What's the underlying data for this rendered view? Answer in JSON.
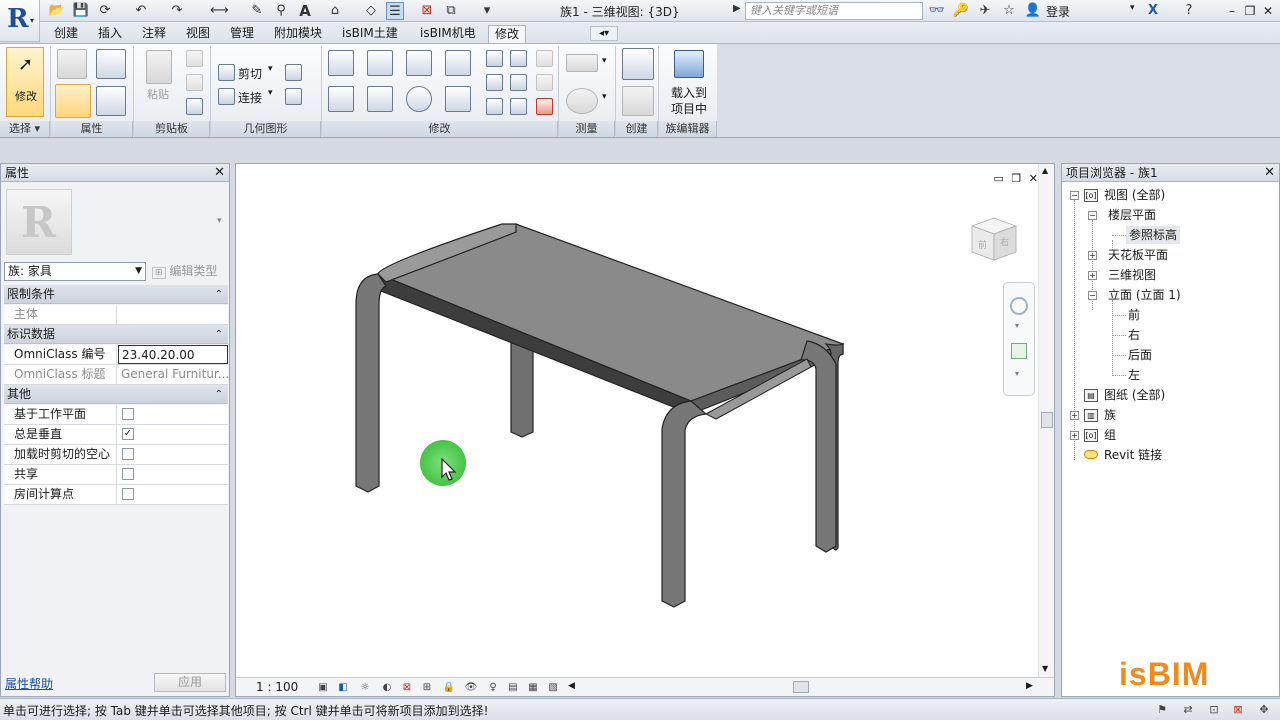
{
  "titlebar": {
    "title": "族1 - 三维视图: {3D}",
    "search_placeholder": "键入关键字或短语",
    "login": "登录"
  },
  "tabs": [
    {
      "label": "创建"
    },
    {
      "label": "插入"
    },
    {
      "label": "注释"
    },
    {
      "label": "视图"
    },
    {
      "label": "管理"
    },
    {
      "label": "附加模块"
    },
    {
      "label": "isBIM土建"
    },
    {
      "label": "isBIM机电"
    },
    {
      "label": "修改"
    }
  ],
  "ribbon": {
    "modify_label": "修改",
    "paste_label": "粘贴",
    "cut_label": "剪切",
    "join_label": "连接",
    "load_label_1": "载入到",
    "load_label_2": "项目中",
    "panels": {
      "select": "选择",
      "properties": "属性",
      "clipboard": "剪贴板",
      "geometry": "几何图形",
      "modify": "修改",
      "measure": "测量",
      "create": "创建",
      "family_editor": "族编辑器"
    }
  },
  "properties": {
    "title": "属性",
    "family_select": "族: 家具",
    "edit_type": "编辑类型",
    "sections": [
      {
        "label": "限制条件"
      },
      {
        "label": "标识数据"
      },
      {
        "label": "其他"
      }
    ],
    "rows": {
      "host": {
        "name": "主体",
        "value": ""
      },
      "omniclass_number": {
        "name": "OmniClass 编号",
        "value": "23.40.20.00"
      },
      "omniclass_title": {
        "name": "OmniClass 标题",
        "value": "General Furnitur..."
      },
      "work_plane": {
        "name": "基于工作平面",
        "checked": false
      },
      "always_vertical": {
        "name": "总是垂直",
        "checked": true
      },
      "cut_voids": {
        "name": "加载时剪切的空心",
        "checked": false
      },
      "shared": {
        "name": "共享",
        "checked": false
      },
      "room_point": {
        "name": "房间计算点",
        "checked": false
      }
    },
    "help": "属性帮助",
    "apply": "应用"
  },
  "viewport": {
    "scale": "1 : 100",
    "viewcube_front": "前",
    "viewcube_right": "右"
  },
  "browser": {
    "title": "项目浏览器 - 族1",
    "nodes": {
      "views": "视图 (全部)",
      "floor_plans": "楼层平面",
      "ref_level": "参照标高",
      "ceiling_plans": "天花板平面",
      "three_d": "三维视图",
      "elevations": "立面 (立面 1)",
      "front": "前",
      "right": "右",
      "back": "后面",
      "left": "左",
      "sheets": "图纸 (全部)",
      "families": "族",
      "groups": "组",
      "revit_links": "Revit 链接"
    },
    "logo": "isBIM"
  },
  "status": {
    "text": "单击可进行选择; 按 Tab 键并单击可选择其他项目; 按 Ctrl 键并单击可将新项目添加到选择!"
  },
  "colors": {
    "accent": "#1f4f9a",
    "cursor_halo": "#45c445",
    "logo": "#f28a1a"
  }
}
